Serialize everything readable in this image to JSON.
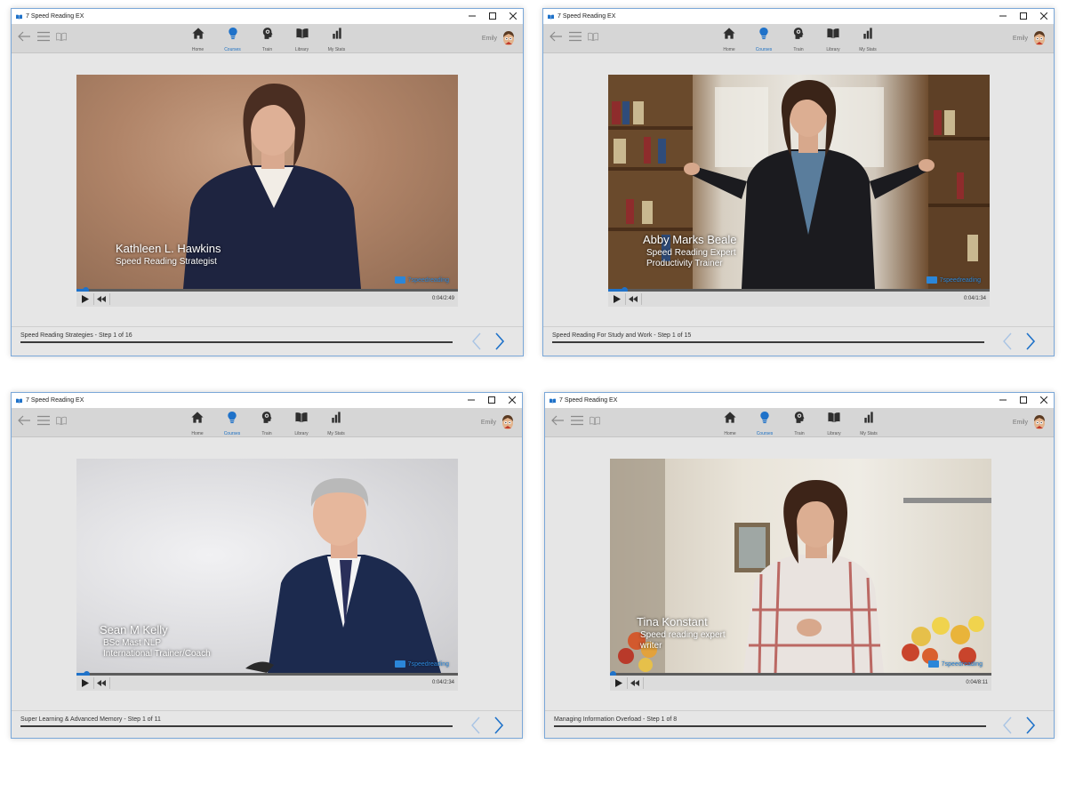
{
  "app": {
    "title": "7 Speed Reading EX",
    "user": "Emily"
  },
  "nav": [
    {
      "label": "Home",
      "icon": "home-icon",
      "active": false
    },
    {
      "label": "Courses",
      "icon": "lightbulb-icon",
      "active": true
    },
    {
      "label": "Train",
      "icon": "brain-head-icon",
      "active": false
    },
    {
      "label": "Library",
      "icon": "book-icon",
      "active": false
    },
    {
      "label": "My Stats",
      "icon": "bar-chart-icon",
      "active": false
    }
  ],
  "colors": {
    "accent": "#1f72c9",
    "toolbar": "#d6d6d6",
    "window_bg": "#e6e6e6",
    "border": "#7aa7d8"
  },
  "brand_label": "7speedreading",
  "windows": [
    {
      "presenter": "Kathleen L. Hawkins",
      "titles": [
        "Speed Reading Strategist"
      ],
      "time": "0:04/2:49",
      "progress": 0.024,
      "step": "Speed Reading Strategies - Step 1 of 16"
    },
    {
      "presenter": "Abby Marks Beale",
      "titles": [
        "Speed Reading Expert",
        "Productivity Trainer"
      ],
      "time": "0:04/1:34",
      "progress": 0.043,
      "step": "Speed Reading For Study and Work - Step 1 of 15"
    },
    {
      "presenter": "Sean M Kelly",
      "titles": [
        "BSc Mast NLP",
        "International Trainer/Coach"
      ],
      "time": "0:04/2:34",
      "progress": 0.026,
      "step": "Super Learning & Advanced Memory - Step 1 of 11"
    },
    {
      "presenter": "Tina Konstant",
      "titles": [
        "Speed reading expert",
        "writer"
      ],
      "time": "0:04/8:11",
      "progress": 0.008,
      "step": "Managing Information Overload - Step 1 of 8"
    }
  ]
}
